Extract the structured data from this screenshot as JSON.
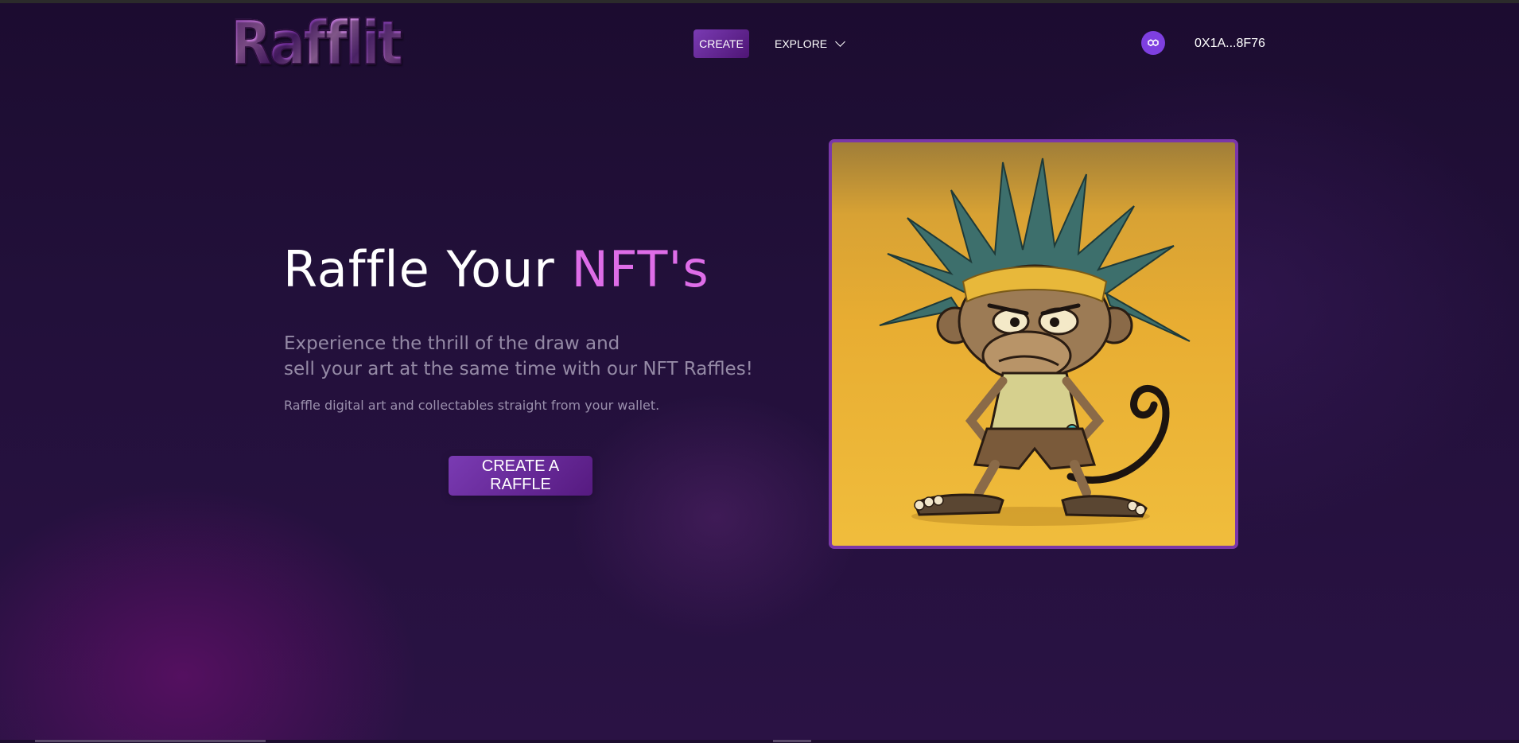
{
  "header": {
    "logo_text": "Rafflit",
    "nav": {
      "create_label": "CREATE",
      "explore_label": "EXPLORE"
    },
    "network_icon": "polygon-icon",
    "wallet_address": "0X1A...8F76"
  },
  "hero": {
    "title_main": "Raffle Your ",
    "title_accent": "NFT's",
    "subtitle_line1": "Experience the thrill of the draw and",
    "subtitle_line2": "sell your art at the same time with our NFT Raffles!",
    "description": "Raffle digital art and collectables straight from your wallet.",
    "cta_label": "CREATE A RAFFLE"
  },
  "colors": {
    "background": "#22103a",
    "accent_pink": "#de6de8",
    "button_purple": "#7a3bb3",
    "frame_purple": "#7a37a8",
    "network_purple": "#7e3fe0",
    "art_background": "#e8ad32"
  }
}
